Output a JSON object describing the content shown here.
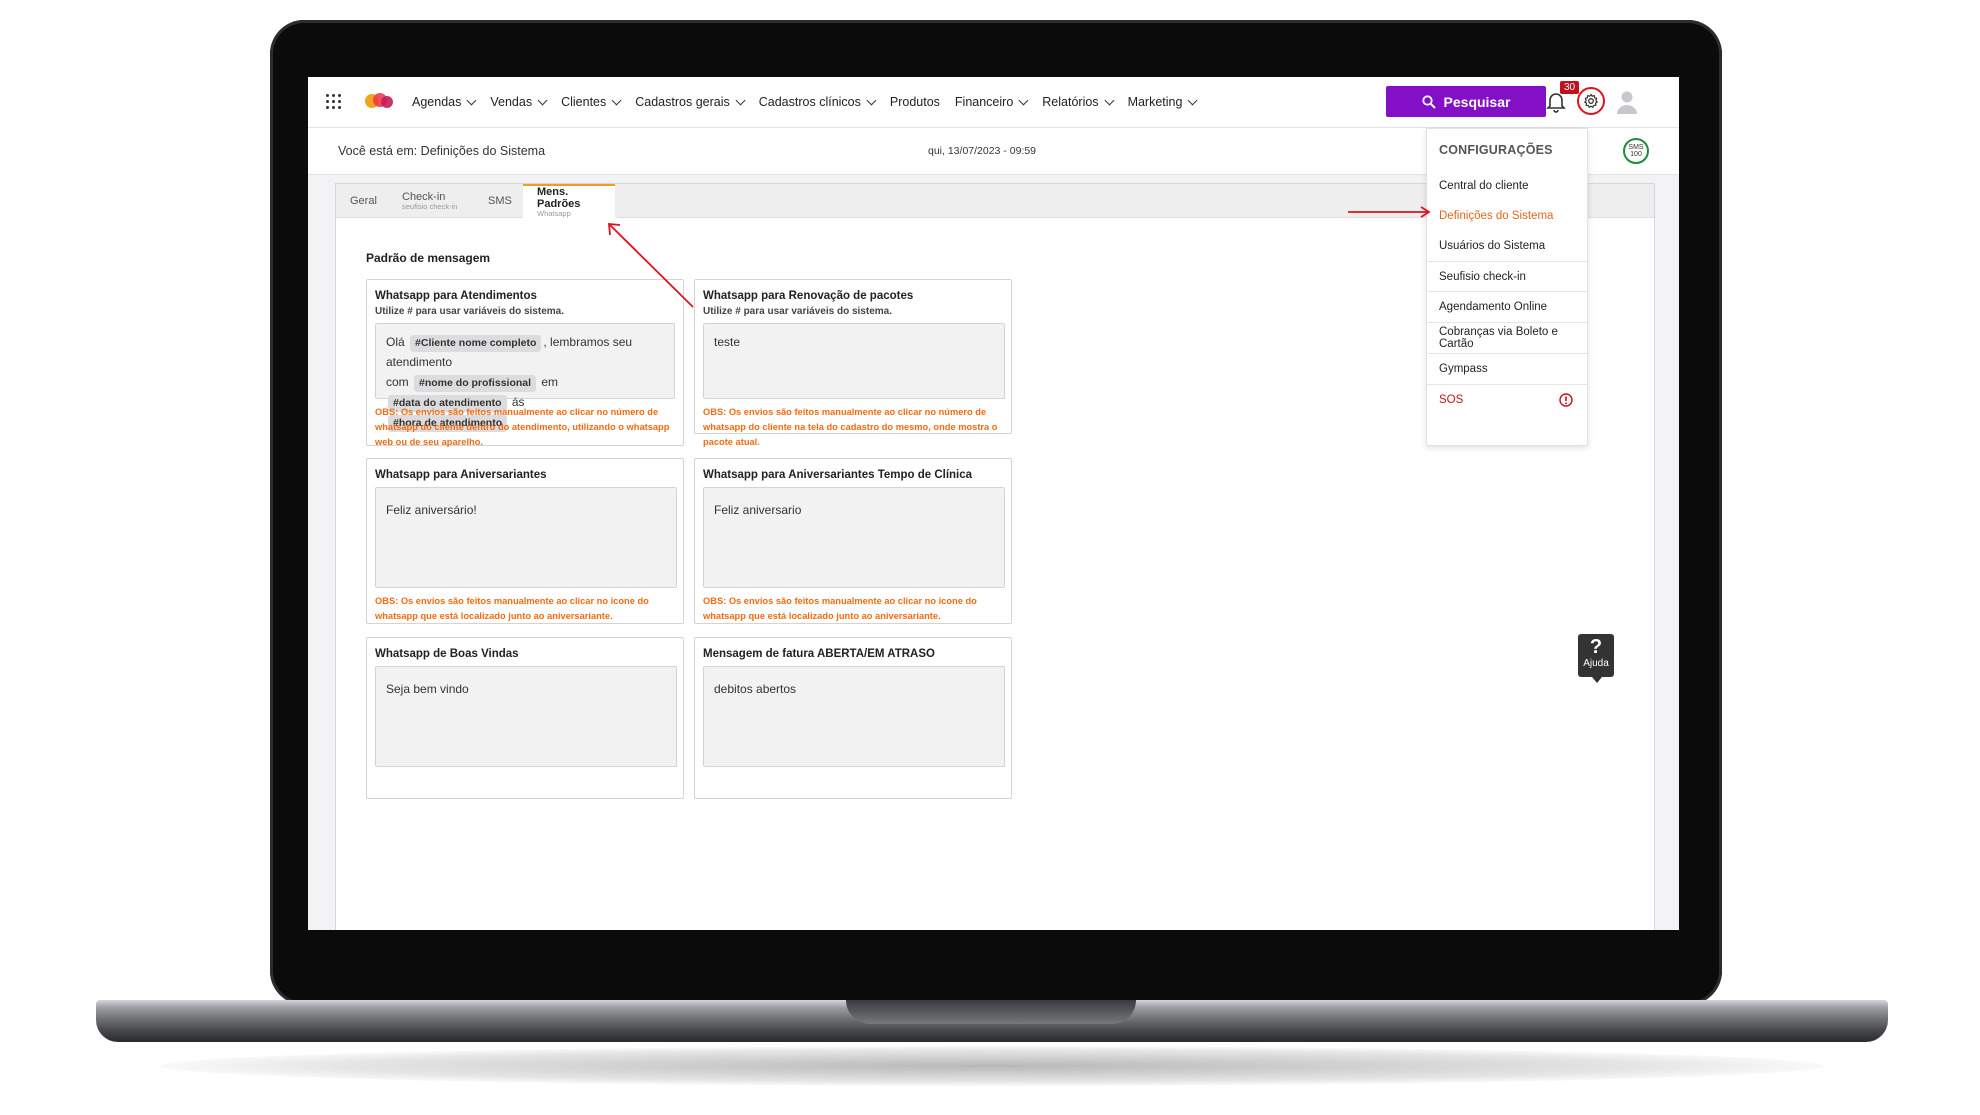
{
  "nav": {
    "items": [
      "Agendas",
      "Vendas",
      "Clientes",
      "Cadastros gerais",
      "Cadastros clínicos",
      "Produtos",
      "Financeiro",
      "Relatórios",
      "Marketing"
    ],
    "dropdowns": [
      true,
      true,
      true,
      true,
      true,
      false,
      true,
      true,
      true
    ],
    "search_label": "Pesquisar",
    "notifications": "30"
  },
  "subbar": {
    "breadcrumb": "Você está em: Definições do Sistema",
    "datetime": "qui, 13/07/2023 - 09:59",
    "sms_badge": "SMS 100"
  },
  "tabs": [
    {
      "label": "Geral",
      "sub": ""
    },
    {
      "label": "Check-in",
      "sub": "seufisio check-in"
    },
    {
      "label": "SMS",
      "sub": ""
    },
    {
      "label": "Mens. Padrões",
      "sub": "Whatsapp"
    }
  ],
  "section_title": "Padrão de mensagem",
  "cards": {
    "atendimentos": {
      "title": "Whatsapp para Atendimentos",
      "subtitle": "Utilize # para usar variáveis do sistema.",
      "msg_ola": "Olá",
      "tag_cliente": "#Cliente nome completo",
      "msg_lembramos": ", lembramos seu atendimento",
      "msg_com": "com",
      "tag_profissional": "#nome do profissional",
      "msg_em": "em",
      "tag_data": "#data do atendimento",
      "msg_as": "ás",
      "tag_hora": "#hora de atendimento",
      "obs": "OBS: Os envios são feitos manualmente ao clicar no número de whatsapp do cliente dentro do atendimento, utilizando o whatsapp web ou de seu aparelho."
    },
    "renovacao": {
      "title": "Whatsapp para Renovação de pacotes",
      "subtitle": "Utilize # para usar variáveis do sistema.",
      "text": "teste",
      "obs": "OBS: Os envios são feitos manualmente ao clicar no número de whatsapp do cliente na tela do cadastro do mesmo, onde mostra o pacote atual."
    },
    "aniversariantes": {
      "title": "Whatsapp para Aniversariantes",
      "text": "Feliz aniversário!",
      "obs": "OBS: Os envios são feitos manualmente ao clicar no icone do whatsapp que está localizado junto ao aniversariante."
    },
    "aniv_tempo": {
      "title": "Whatsapp para Aniversariantes Tempo de Clínica",
      "text": "Feliz aniversario",
      "obs": "OBS: Os envios são feitos manualmente ao clicar no icone do whatsapp que está localizado junto ao aniversariante."
    },
    "boas_vindas": {
      "title": "Whatsapp de Boas Vindas",
      "text": "Seja bem vindo"
    },
    "fatura": {
      "title": "Mensagem de fatura ABERTA/EM ATRASO",
      "text": "debitos abertos"
    }
  },
  "config_menu": {
    "title": "CONFIGURAÇÕES",
    "items": [
      "Central do cliente",
      "Definições do Sistema",
      "Usuários do Sistema",
      "Seufisio check-in",
      "Agendamento Online",
      "Cobranças via Boleto e Cartão",
      "Gympass",
      "SOS"
    ]
  },
  "help": {
    "symbol": "?",
    "label": "Ajuda"
  },
  "colors": {
    "accent_purple": "#8310c7",
    "highlight_orange": "#e8641a",
    "obs_orange": "#f26b10",
    "annotation_red": "#e0121d",
    "tab_active_border": "#f59a1f"
  }
}
